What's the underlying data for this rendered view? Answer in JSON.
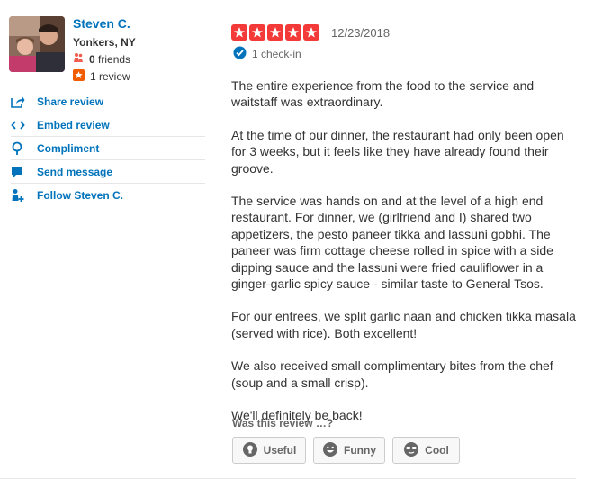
{
  "user": {
    "name": "Steven C.",
    "location": "Yonkers, NY",
    "friends_count": "0",
    "friends_label": "friends",
    "reviews_label": "1 review"
  },
  "actions": [
    {
      "label": "Share review",
      "icon": "share-icon"
    },
    {
      "label": "Embed review",
      "icon": "embed-icon"
    },
    {
      "label": "Compliment",
      "icon": "compliment-icon"
    },
    {
      "label": "Send message",
      "icon": "message-icon"
    },
    {
      "label": "Follow Steven C.",
      "icon": "follow-icon"
    }
  ],
  "review": {
    "rating": 5,
    "date": "12/23/2018",
    "checkin": "1 check-in",
    "paragraphs": [
      "The entire experience from the food to the service and waitstaff was extraordinary.",
      "At the time of our dinner, the restaurant had only been open for 3 weeks, but it feels like they have already found their groove.",
      "The service was hands on and at the level of a high end restaurant. For dinner, we (girlfriend and I) shared two appetizers, the pesto paneer tikka and lassuni gobhi. The paneer was firm cottage cheese rolled in spice with a side dipping sauce and the lassuni were fried cauliflower in a ginger-garlic spicy sauce - similar taste to General Tsos.",
      "For our entrees, we split garlic naan and chicken tikka masala (served with rice). Both excellent!",
      "We also received small complimentary bites from the chef (soup and a small crisp).",
      "We'll definitely be back!"
    ]
  },
  "feedback": {
    "prompt": "Was this review …?",
    "useful": "Useful",
    "funny": "Funny",
    "cool": "Cool"
  },
  "colors": {
    "link": "#0073bb",
    "star": "#f43939",
    "friends_icon": "#f15c4f",
    "review_badge": "#f15c00",
    "verified": "#0073bb"
  }
}
